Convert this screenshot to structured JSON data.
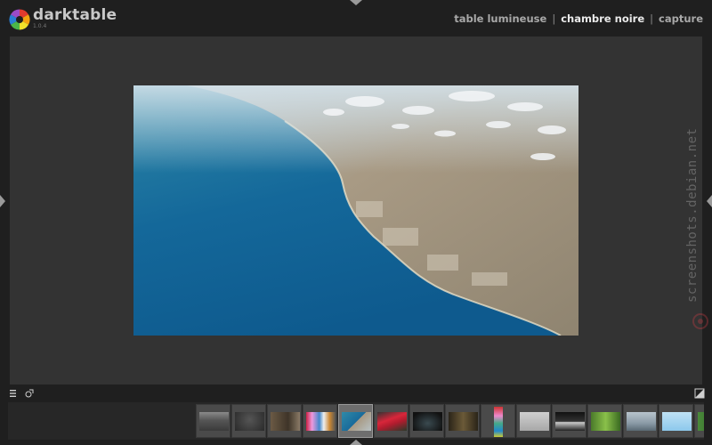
{
  "app": {
    "name": "darktable",
    "version": "1.0.4"
  },
  "views": [
    {
      "label": "table lumineuse",
      "active": false
    },
    {
      "label": "chambre noire",
      "active": true
    },
    {
      "label": "capture",
      "active": false
    }
  ],
  "view_separator": "|",
  "watermark": "screenshots.debian.net",
  "icons": {
    "logo": "aperture-logo-icon",
    "menu": "hamburger-menu-icon",
    "styles": "styles-icon",
    "display": "toggle-display-icon"
  },
  "colors": {
    "background": "#1f1f1f",
    "center_view": "#333333",
    "active_view": "#eaeaea",
    "inactive_view": "#a8a8a8"
  },
  "filmstrip": {
    "selected_index": 4,
    "thumbnails": [
      "dark-landscape",
      "dark-texture",
      "brown-still",
      "colorful-crowd",
      "aerial-coast",
      "red-object",
      "dark-tunnel",
      "dark-interior",
      "portrait-colorful",
      "grey-scene",
      "dark-horizon",
      "green-plants",
      "cloudy-sky",
      "light-blue-sky",
      "green-edge"
    ]
  }
}
